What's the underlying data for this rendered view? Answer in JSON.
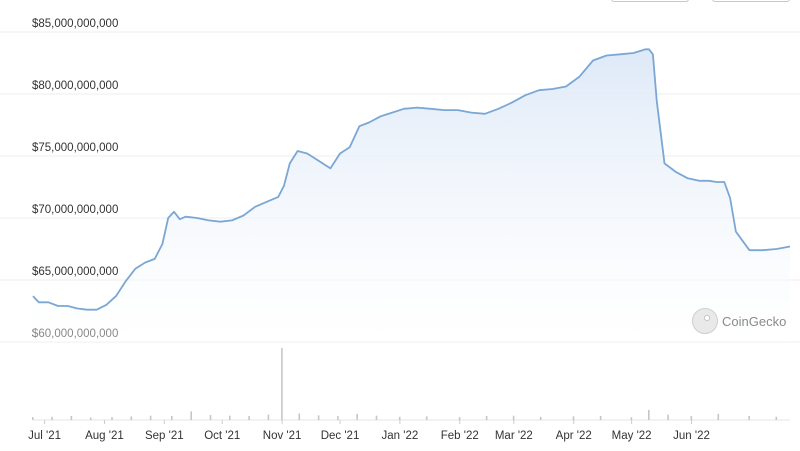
{
  "watermark": {
    "text": "CoinGecko",
    "icon": "gecko-logo-icon"
  },
  "colors": {
    "line": "#7aa7d4",
    "fill_top": "#dce8f7",
    "fill_bottom": "#ffffff",
    "volume": "#c6c6c6",
    "grid": "#ececec"
  },
  "chart_data": {
    "type": "area",
    "title": "",
    "xlabel": "",
    "ylabel": "",
    "ylim": [
      60000000000,
      85000000000
    ],
    "yticks": [
      60000000000,
      65000000000,
      70000000000,
      75000000000,
      80000000000,
      85000000000
    ],
    "ytick_labels": [
      "$60,000,000,000",
      "$65,000,000,000",
      "$70,000,000,000",
      "$75,000,000,000",
      "$80,000,000,000",
      "$85,000,000,000"
    ],
    "xlim": [
      "2021-06-25",
      "2022-07-22"
    ],
    "xticks": [
      "2021-07-01",
      "2021-08-01",
      "2021-09-01",
      "2021-10-01",
      "2021-11-01",
      "2021-12-01",
      "2022-01-01",
      "2022-02-01",
      "2022-03-01",
      "2022-04-01",
      "2022-05-01",
      "2022-06-01"
    ],
    "xtick_labels": [
      "Jul '21",
      "Aug '21",
      "Sep '21",
      "Oct '21",
      "Nov '21",
      "Dec '21",
      "Jan '22",
      "Feb '22",
      "Mar '22",
      "Apr '22",
      "May '22",
      "Jun '22"
    ],
    "grid": true,
    "series": [
      {
        "x": [
          "2021-06-25",
          "2021-06-28",
          "2021-07-03",
          "2021-07-08",
          "2021-07-13",
          "2021-07-18",
          "2021-07-23",
          "2021-07-28",
          "2021-08-02",
          "2021-08-07",
          "2021-08-12",
          "2021-08-17",
          "2021-08-22",
          "2021-08-27",
          "2021-08-31",
          "2021-09-03",
          "2021-09-06",
          "2021-09-09",
          "2021-09-12",
          "2021-09-18",
          "2021-09-24",
          "2021-09-30",
          "2021-10-06",
          "2021-10-12",
          "2021-10-18",
          "2021-10-24",
          "2021-10-30",
          "2021-11-02",
          "2021-11-05",
          "2021-11-09",
          "2021-11-14",
          "2021-11-20",
          "2021-11-26",
          "2021-12-01",
          "2021-12-06",
          "2021-12-11",
          "2021-12-16",
          "2021-12-22",
          "2021-12-28",
          "2022-01-03",
          "2022-01-10",
          "2022-01-17",
          "2022-01-24",
          "2022-01-31",
          "2022-02-07",
          "2022-02-14",
          "2022-02-21",
          "2022-02-28",
          "2022-03-07",
          "2022-03-14",
          "2022-03-21",
          "2022-03-28",
          "2022-04-04",
          "2022-04-11",
          "2022-04-18",
          "2022-04-25",
          "2022-05-02",
          "2022-05-06",
          "2022-05-08",
          "2022-05-10",
          "2022-05-12",
          "2022-05-14",
          "2022-05-18",
          "2022-05-24",
          "2022-05-30",
          "2022-06-05",
          "2022-06-10",
          "2022-06-14",
          "2022-06-18",
          "2022-06-21",
          "2022-06-24",
          "2022-07-01",
          "2022-07-08",
          "2022-07-15",
          "2022-07-22"
        ],
        "values": [
          63300000000,
          62800000000,
          62800000000,
          62500000000,
          62500000000,
          62300000000,
          62200000000,
          62200000000,
          62600000000,
          63300000000,
          64500000000,
          65500000000,
          66000000000,
          66300000000,
          67500000000,
          69600000000,
          70100000000,
          69500000000,
          69700000000,
          69600000000,
          69400000000,
          69300000000,
          69400000000,
          69800000000,
          70500000000,
          70900000000,
          71300000000,
          72200000000,
          74000000000,
          75000000000,
          74800000000,
          74200000000,
          73600000000,
          74800000000,
          75300000000,
          77000000000,
          77300000000,
          77800000000,
          78100000000,
          78400000000,
          78500000000,
          78400000000,
          78300000000,
          78300000000,
          78100000000,
          78000000000,
          78400000000,
          78900000000,
          79500000000,
          79900000000,
          80000000000,
          80200000000,
          81000000000,
          82300000000,
          82700000000,
          82800000000,
          82900000000,
          83100000000,
          83200000000,
          83200000000,
          82800000000,
          79000000000,
          74000000000,
          73300000000,
          72800000000,
          72600000000,
          72600000000,
          72500000000,
          72500000000,
          71200000000,
          68500000000,
          67000000000,
          67000000000,
          67100000000,
          67300000000
        ]
      }
    ],
    "volume": {
      "ylim": [
        0,
        1000
      ],
      "x": [
        "2021-06-25",
        "2021-07-05",
        "2021-07-15",
        "2021-07-25",
        "2021-08-05",
        "2021-08-15",
        "2021-08-25",
        "2021-09-05",
        "2021-09-15",
        "2021-09-25",
        "2021-10-05",
        "2021-10-15",
        "2021-10-25",
        "2021-11-01",
        "2021-11-10",
        "2021-11-20",
        "2021-11-30",
        "2021-12-10",
        "2021-12-20",
        "2022-01-01",
        "2022-01-15",
        "2022-02-01",
        "2022-02-15",
        "2022-03-01",
        "2022-03-15",
        "2022-04-01",
        "2022-04-15",
        "2022-05-01",
        "2022-05-10",
        "2022-05-20",
        "2022-06-01",
        "2022-06-15",
        "2022-07-01",
        "2022-07-15"
      ],
      "values": [
        40,
        45,
        55,
        35,
        40,
        50,
        60,
        55,
        120,
        70,
        60,
        55,
        75,
        1000,
        90,
        65,
        55,
        85,
        60,
        45,
        50,
        40,
        55,
        60,
        45,
        50,
        55,
        40,
        140,
        75,
        55,
        85,
        55,
        45
      ]
    }
  }
}
